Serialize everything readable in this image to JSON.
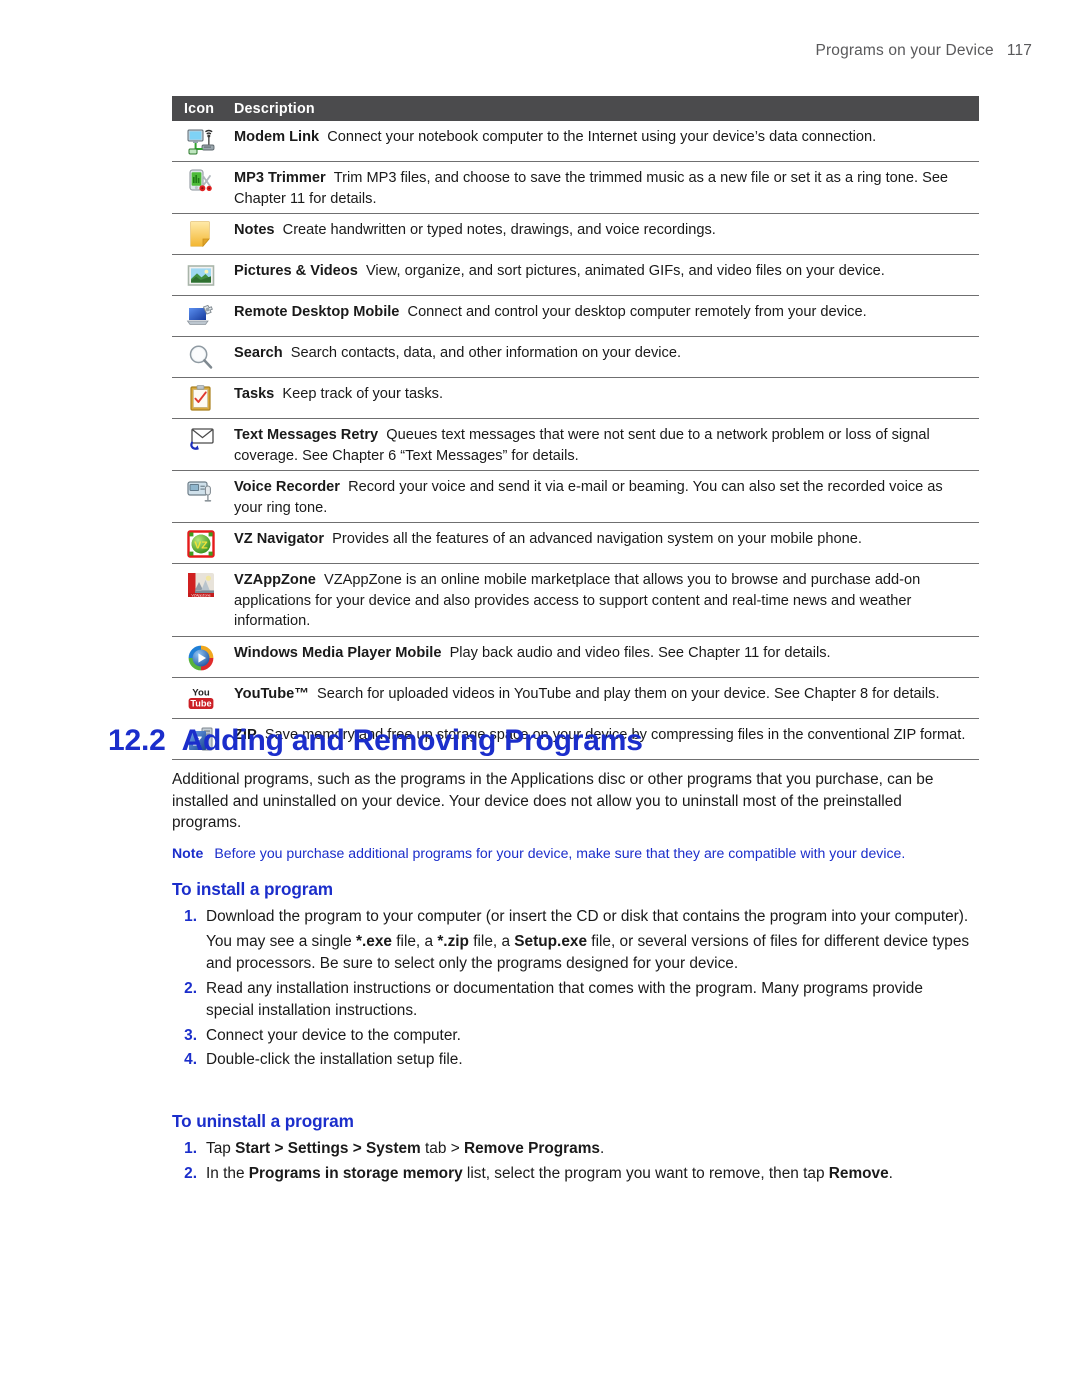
{
  "header": {
    "title": "Programs on your Device",
    "page_number": "117"
  },
  "table": {
    "columns": {
      "icon": "Icon",
      "description": "Description"
    },
    "rows": [
      {
        "icon": "modem-link-icon",
        "name": "Modem Link",
        "desc": "Connect your notebook computer to the Internet using your device’s data connection."
      },
      {
        "icon": "mp3-trimmer-icon",
        "name": "MP3 Trimmer",
        "desc": "Trim MP3 files, and choose to save the trimmed music as a new file or set it as a ring tone. See Chapter 11 for details."
      },
      {
        "icon": "notes-icon",
        "name": "Notes",
        "desc": "Create handwritten or typed notes, drawings, and voice recordings."
      },
      {
        "icon": "pictures-videos-icon",
        "name": "Pictures & Videos",
        "desc": "View, organize, and sort pictures, animated GIFs, and video files on your device."
      },
      {
        "icon": "remote-desktop-mobile-icon",
        "name": "Remote Desktop Mobile",
        "desc": "Connect and control your desktop computer remotely from your device."
      },
      {
        "icon": "search-icon",
        "name": "Search",
        "desc": "Search contacts, data, and other information on your device."
      },
      {
        "icon": "tasks-icon",
        "name": "Tasks",
        "desc": "Keep track of your tasks."
      },
      {
        "icon": "text-messages-retry-icon",
        "name": "Text Messages Retry",
        "desc": "Queues text messages that were not sent due to a network problem or loss of signal coverage. See Chapter 6 “Text Messages” for details."
      },
      {
        "icon": "voice-recorder-icon",
        "name": "Voice Recorder",
        "desc": "Record your voice and send it via e-mail or beaming. You can also set the recorded voice as your ring tone."
      },
      {
        "icon": "vz-navigator-icon",
        "name": "VZ Navigator",
        "desc": "Provides all the features of an advanced navigation system on your mobile phone."
      },
      {
        "icon": "vzappzone-icon",
        "name": "VZAppZone",
        "desc": "VZAppZone is an online mobile marketplace that allows you to browse and purchase add-on applications for your device and also provides access to support content and real-time news and weather information."
      },
      {
        "icon": "windows-media-player-mobile-icon",
        "name": "Windows Media Player Mobile",
        "desc": "Play back audio and video files. See Chapter 11 for details."
      },
      {
        "icon": "youtube-icon",
        "name": "YouTube™",
        "desc": "Search for uploaded videos in YouTube and play them on your device. See Chapter 8 for details."
      },
      {
        "icon": "zip-icon",
        "name": "ZIP",
        "desc": "Save memory and free up storage space on your device by compressing files in the conventional ZIP format."
      }
    ]
  },
  "section": {
    "number": "12.2",
    "title": "Adding and Removing Programs",
    "intro": "Additional programs, such as the programs in the Applications disc or other programs that you purchase, can be installed and uninstalled on your device. Your device does not allow you to uninstall most of the preinstalled programs.",
    "note_label": "Note",
    "note_text": "Before you purchase additional programs for your device, make sure that they are compatible with your device."
  },
  "install": {
    "heading": "To install a program",
    "steps": [
      {
        "marker": "1.",
        "text_1": "Download the program to your computer (or insert the CD or disk that contains the program into your computer)."
      },
      {
        "marker": "2.",
        "text_1": "Read any installation instructions or documentation that comes with the program. Many programs provide special installation instructions."
      },
      {
        "marker": "3.",
        "text_1": "Connect your device to the computer."
      },
      {
        "marker": "4.",
        "text_1": "Double-click the installation setup file."
      }
    ],
    "sub_para": {
      "a": "You may see a single ",
      "b_exe": "*.exe",
      "c": " file, a ",
      "d_zip": "*.zip",
      "e": " file, a ",
      "f_setup": "Setup.exe",
      "g": " file, or several versions of files for different device types and processors. Be sure to select only the programs designed for your device."
    }
  },
  "uninstall": {
    "heading": "To uninstall a program",
    "step1": {
      "marker": "1.",
      "a": "Tap ",
      "b_start": "Start",
      "c": " > ",
      "d_settings": "Settings",
      "e": " > ",
      "f_system": "System",
      "g": " tab > ",
      "h_remove_programs": "Remove Programs",
      "i": "."
    },
    "step2": {
      "marker": "2.",
      "a": "In the ",
      "b_list": "Programs in storage memory",
      "c": " list, select the program you want to remove, then tap ",
      "d_remove": "Remove",
      "e": "."
    }
  },
  "colors": {
    "accent_blue": "#1b2ecb",
    "table_header_bg": "#4b4b4d",
    "rule": "#6f6f70",
    "header_text": "#59595b"
  }
}
